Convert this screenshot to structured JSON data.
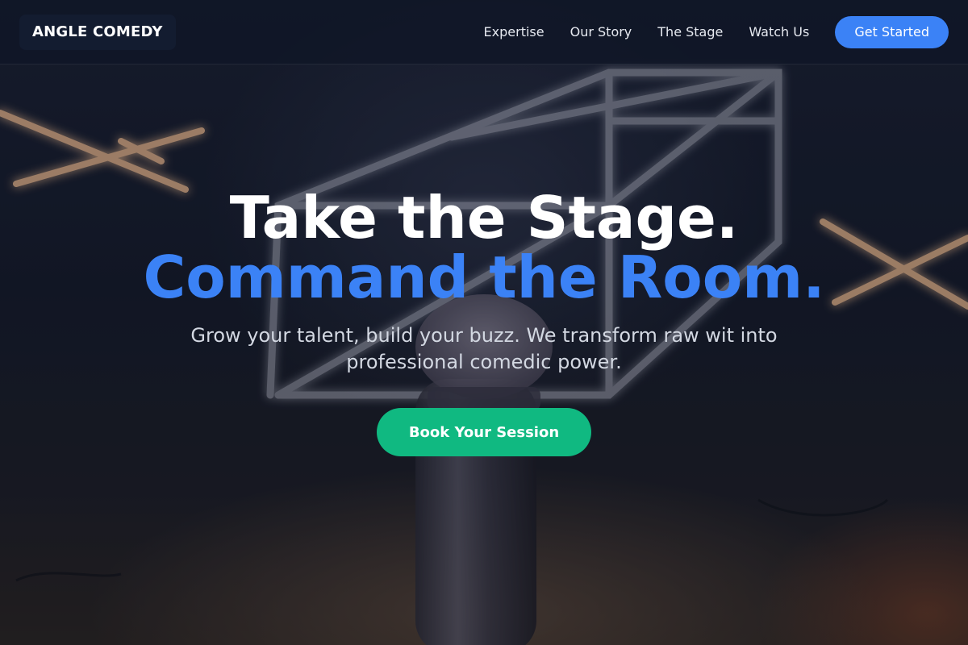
{
  "header": {
    "logo": "ANGLE COMEDY",
    "nav": [
      "Expertise",
      "Our Story",
      "The Stage",
      "Watch Us"
    ],
    "cta": "Get Started"
  },
  "hero": {
    "title_line1": "Take the Stage.",
    "title_line2": "Command the Room.",
    "subtitle": "Grow your talent, build your buzz. We transform raw wit into professional comedic power.",
    "button": "Book Your Session"
  },
  "colors": {
    "accent_blue": "#3b82f6",
    "accent_green": "#10b981",
    "header_bg": "#0f1626"
  }
}
